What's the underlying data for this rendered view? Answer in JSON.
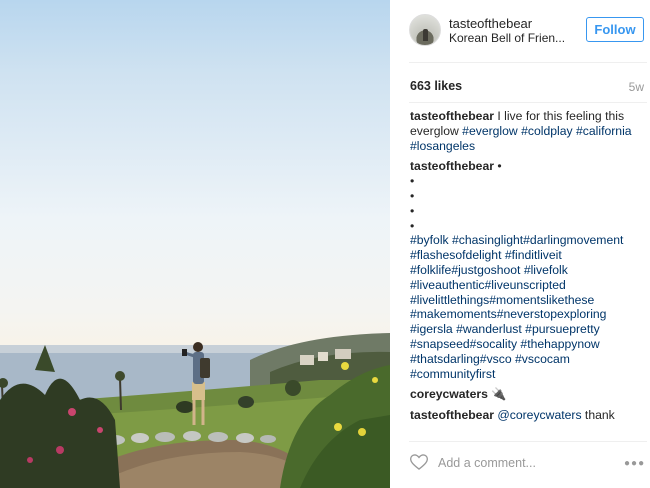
{
  "post": {
    "username": "tasteofthebear",
    "location": "Korean Bell of Frien...",
    "follow_label": "Follow",
    "likes": "663 likes",
    "time_ago": "5w"
  },
  "caption": {
    "user": "tasteofthebear",
    "text": " I live for this feeling this everglow ",
    "tags": [
      "#everglow",
      "#coldplay",
      "#california",
      "#losangeles"
    ]
  },
  "comments": [
    {
      "user": "tasteofthebear",
      "after_user": " •",
      "bullets": [
        "•",
        "•",
        "•",
        "•"
      ],
      "tag_lines": [
        "#byfolk #chasinglight#darlingmovement",
        "#flashesofdelight #finditliveit",
        "#folklife#justgoshoot #livefolk",
        "#liveauthentic#liveunscripted",
        "#livelittlethings#momentslikethese",
        "#makemoments#neverstopexploring",
        "#igersla #wanderlust #pursuepretty",
        "#snapseed#socality #thehappynow",
        "#thatsdarling#vsco #vscocam",
        "#communityfirst"
      ]
    },
    {
      "user": "coreycwaters",
      "text": " 🔌"
    },
    {
      "user": "tasteofthebear",
      "mention": "@coreycwaters",
      "text": " thank"
    }
  ],
  "footer": {
    "comment_placeholder": "Add a comment...",
    "more_glyph": "●●●"
  },
  "icons": {
    "heart": "heart-outline-icon",
    "more": "more-options-icon"
  },
  "colors": {
    "accent": "#3897f0",
    "hashtag": "#003569",
    "muted": "#999999"
  }
}
